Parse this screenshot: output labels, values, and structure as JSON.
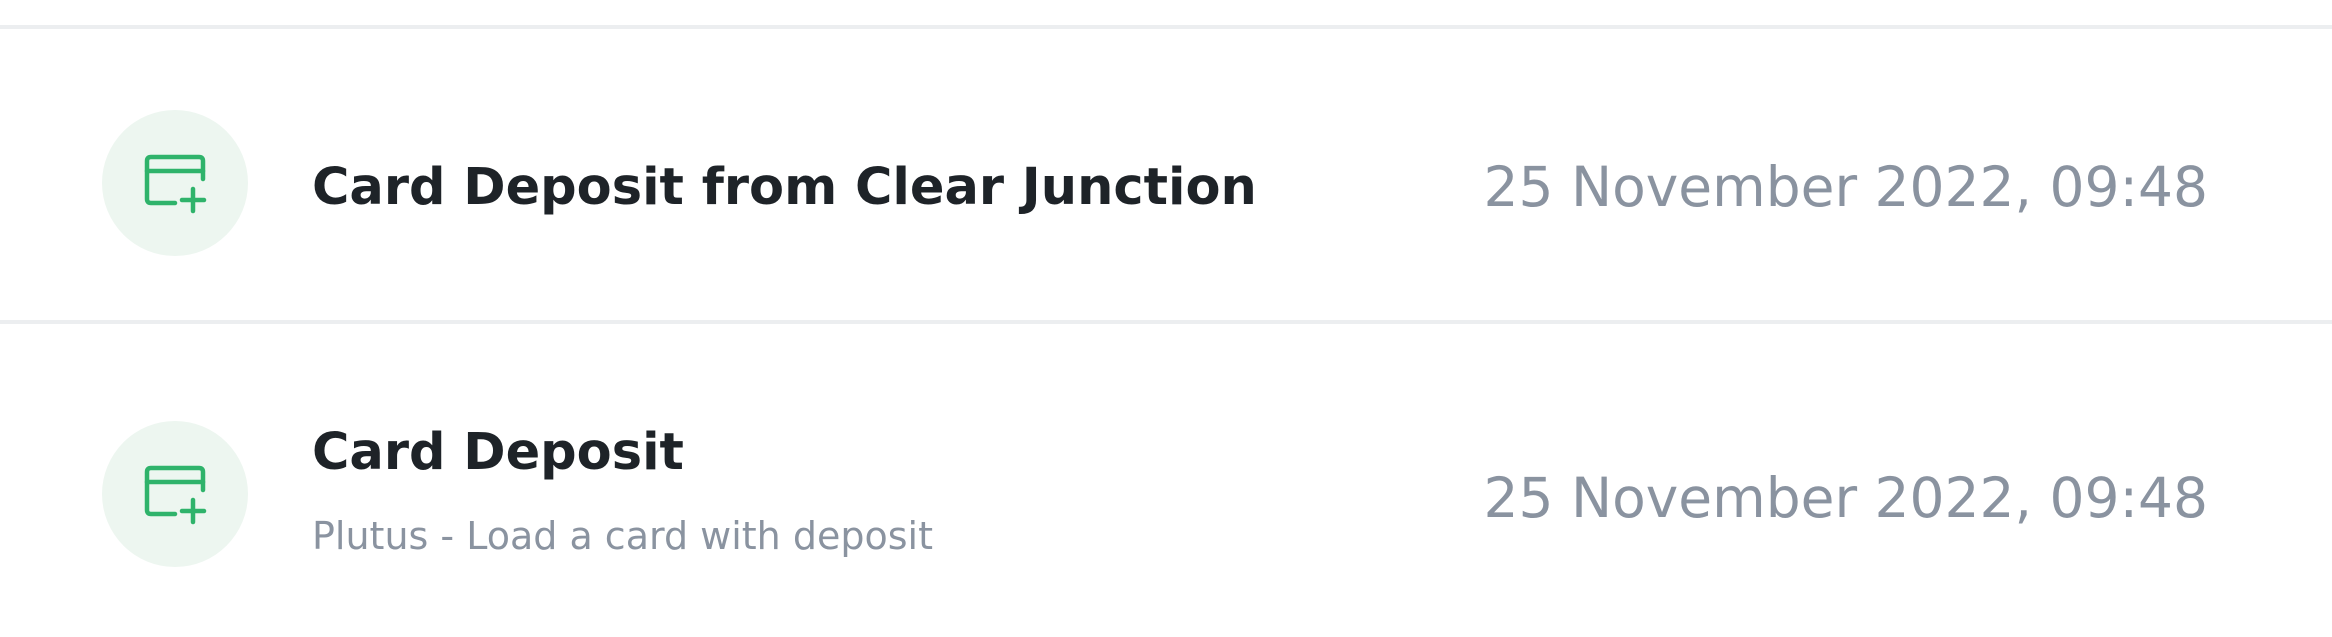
{
  "transactions": [
    {
      "icon": "card-deposit-icon",
      "title": "Card Deposit from Clear Junction",
      "subtitle": "",
      "date": "25 November 2022, 09:48"
    },
    {
      "icon": "card-deposit-icon",
      "title": "Card Deposit",
      "subtitle": "Plutus - Load a card with deposit",
      "date": "25 November 2022, 09:48"
    }
  ],
  "colors": {
    "icon_green": "#2fb36b",
    "icon_background": "#edf6f0",
    "title_text": "#1e2328",
    "muted_text": "#8a93a0",
    "divider": "#eceef0"
  }
}
